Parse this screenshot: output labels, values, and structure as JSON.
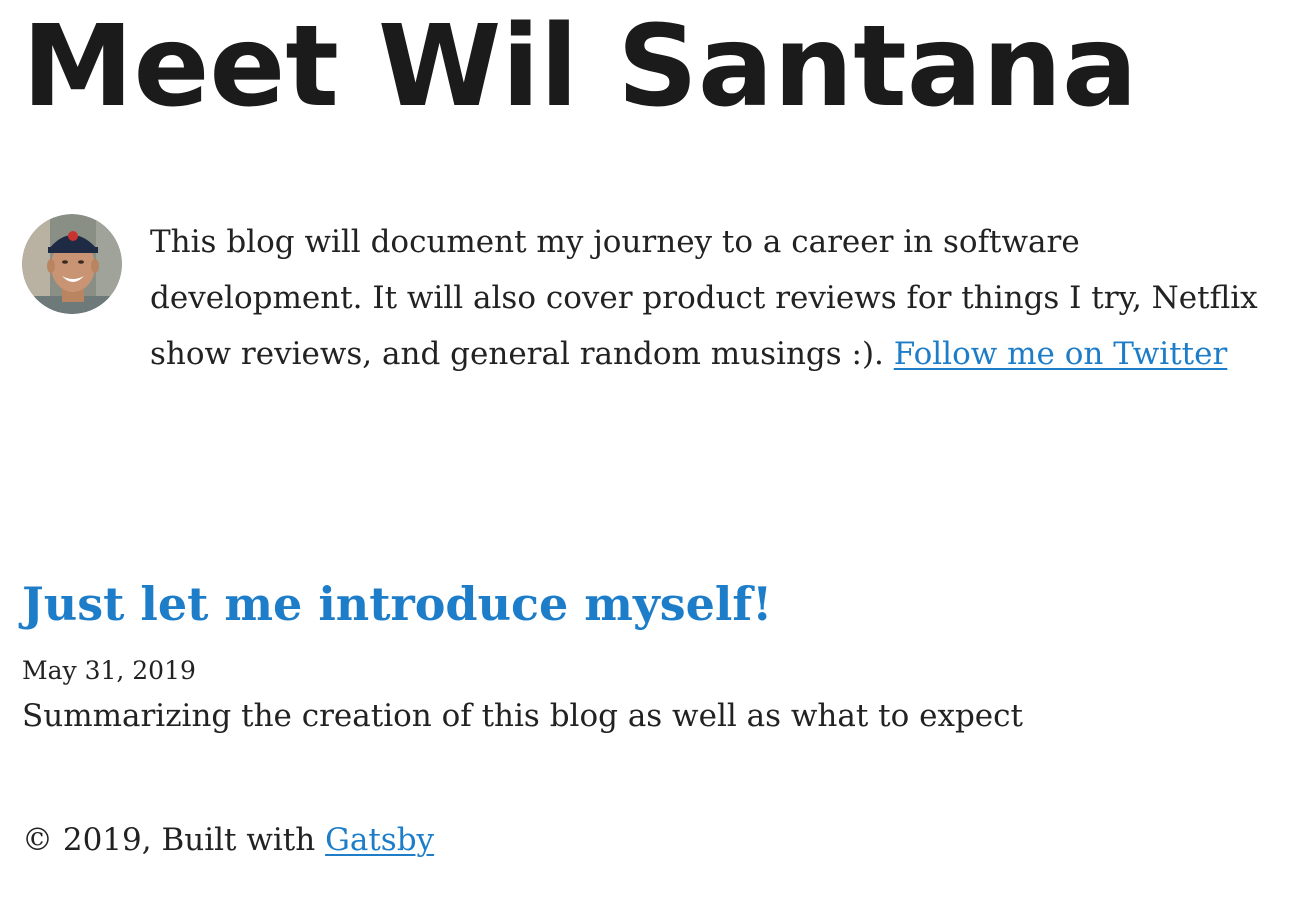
{
  "site": {
    "title": "Meet Wil Santana"
  },
  "bio": {
    "avatar_icon": "avatar-photo-icon",
    "text": "This blog will document my journey to a career in software development. It will also cover product reviews for things I try, Netflix show reviews, and general random musings :). ",
    "twitter_link_label": "Follow me on Twitter"
  },
  "posts": [
    {
      "title": "Just let me introduce myself!",
      "date": "May 31, 2019",
      "excerpt": "Summarizing the creation of this blog as well as what to expect"
    }
  ],
  "footer": {
    "prefix": "© 2019, Built with ",
    "link_label": "Gatsby"
  },
  "colors": {
    "link": "#1d7dc9",
    "text": "#222222",
    "heading": "#1b1b1b"
  }
}
